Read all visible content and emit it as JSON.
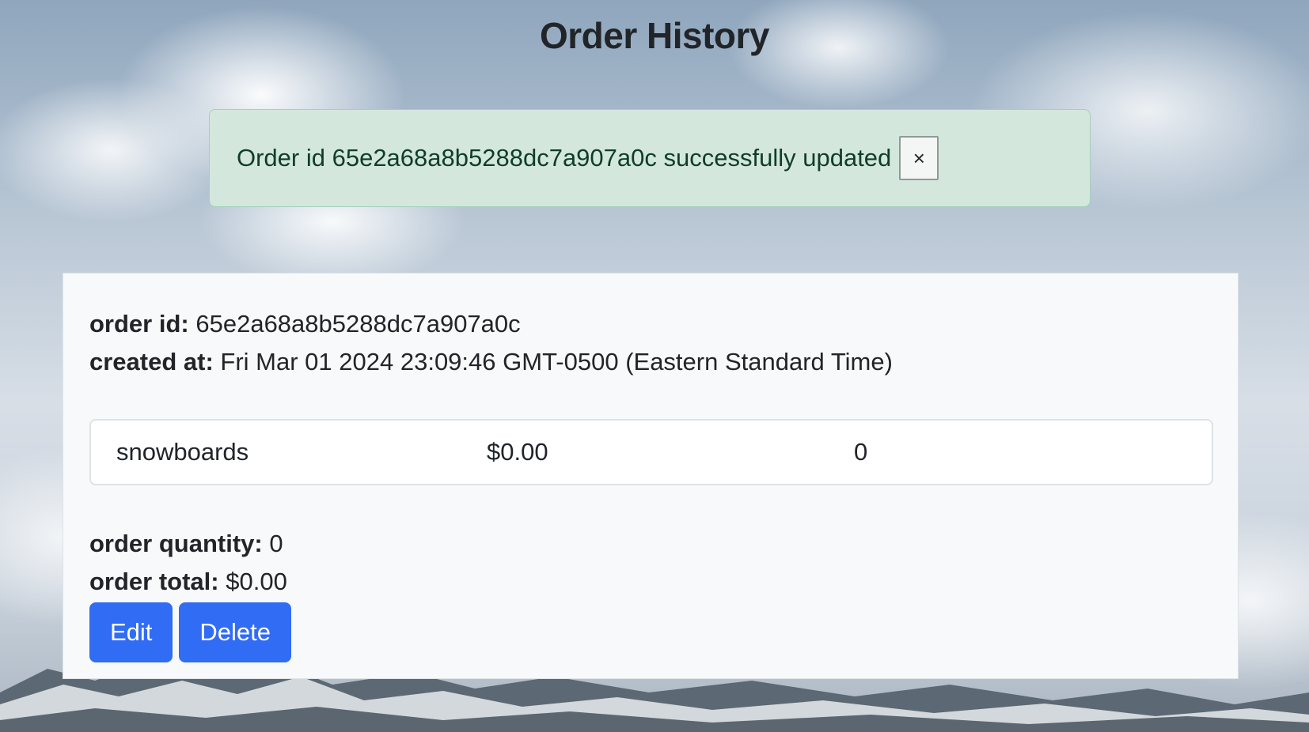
{
  "page": {
    "title": "Order History"
  },
  "alert": {
    "message": "Order id 65e2a68a8b5288dc7a907a0c successfully updated",
    "close_label": "×"
  },
  "order": {
    "id_label": "order id:",
    "id_value": "65e2a68a8b5288dc7a907a0c",
    "created_label": "created at:",
    "created_value": "Fri Mar 01 2024 23:09:46 GMT-0500 (Eastern Standard Time)",
    "items": [
      {
        "name": "snowboards",
        "price": "$0.00",
        "quantity": "0"
      }
    ],
    "quantity_label": "order quantity:",
    "quantity_value": "0",
    "total_label": "order total:",
    "total_value": "$0.00",
    "actions": {
      "edit_label": "Edit",
      "delete_label": "Delete"
    }
  },
  "colors": {
    "primary_button": "#316cf4",
    "alert_background": "#d4e7dd",
    "alert_border": "#a3cfbb",
    "card_background": "#f8f9fa"
  }
}
